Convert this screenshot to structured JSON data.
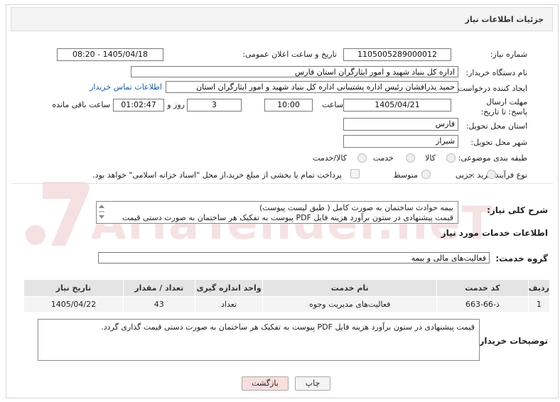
{
  "header": {
    "title": "جزئیات اطلاعات نیاز"
  },
  "fields": {
    "need_number_label": "شماره نیاز:",
    "need_number": "1105005289000012",
    "announce_label": "تاریخ و ساعت اعلان عمومی:",
    "announce_value": "1405/04/18 - 08:20",
    "buyer_org_label": "نام دستگاه خریدار:",
    "buyer_org": "اداره کل بنیاد شهید و امور ایثارگران استان فارس",
    "creator_label": "ایجاد کننده درخواست:",
    "creator": "حمید یذرافشان رئیس اداره پشتیبانی اداره کل بنیاد شهید و امور ایثارگران استان",
    "contact_link": "اطلاعات تماس خریدار",
    "deadline_label": "مهلت ارسال پاسخ: تا تاریخ:",
    "deadline_date": "1405/04/21",
    "time_label": "ساعت",
    "deadline_time": "10:00",
    "days_value": "3",
    "days_label": "روز و",
    "remaining_time": "01:02:47",
    "remaining_label": "ساعت باقی مانده",
    "province_label": "استان محل تحویل:",
    "province": "فارس",
    "city_label": "شهر محل تحویل:",
    "city": "شیراز",
    "category_label": "طبقه بندی موضوعی:",
    "category_options": [
      "کالا",
      "خدمت",
      "کالا/خدمت"
    ],
    "purchase_label": "نوع فرآیند خرید :",
    "purchase_options": [
      "جزیی",
      "متوسط"
    ],
    "payment_note": "پرداخت تمام یا بخشی از مبلغ خرید،از محل \"اسناد خزانه اسلامی\" خواهد بود."
  },
  "summary": {
    "label": "شرح کلی نیاز:",
    "line1": "بیمه حوادث ساختمان به صورت کامل ( طبق لیست پیوست)",
    "line2": "قیمت پیشنهادی در ستون برآورد هزینه فایل PDF پیوست به تفکیک هر ساختمان به صورت دستی قیمت"
  },
  "services": {
    "section_title": "اطلاعات خدمات مورد نیاز",
    "group_label": "گروه خدمت:",
    "group_value": "فعالیت‌های مالی و بیمه",
    "columns": [
      "ردیف",
      "کد خدمت",
      "نام خدمت",
      "واحد اندازه گیری",
      "تعداد / مقدار",
      "تاریخ نیاز"
    ],
    "rows": [
      {
        "row": "1",
        "code": "ذ-66-663",
        "name": "فعالیت‌های مدیریت وجوه",
        "unit": "تعداد",
        "qty": "43",
        "date": "1405/04/22"
      }
    ]
  },
  "buyer_notes": {
    "label": "توضیحات خریدار:",
    "text": "قیمت پیشنهادی در ستون برآورد هزینه فایل PDF پیوست به تفکیک هر ساختمان به صورت دستی قیمت گذاری گردد."
  },
  "buttons": {
    "print": "چاپ",
    "back": "بازگشت"
  },
  "watermark": {
    "text": "AriaTender.neT"
  },
  "colors": {
    "link": "#1a5aa6",
    "back_button_bg": "#f9dede",
    "watermark": "#b41e1e"
  }
}
